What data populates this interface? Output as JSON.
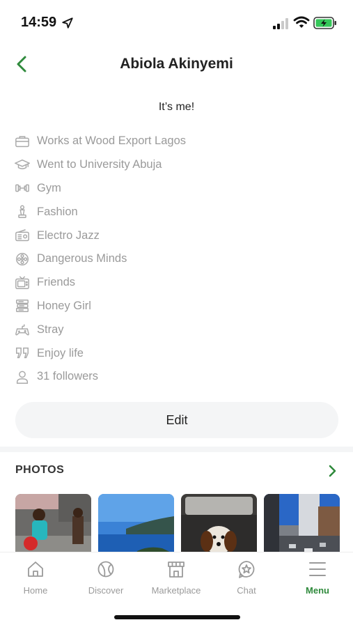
{
  "status_bar": {
    "time": "14:59"
  },
  "header": {
    "title": "Abiola Akinyemi",
    "back_icon": "chevron-left-icon"
  },
  "profile": {
    "bio": "It’s me!",
    "details": [
      {
        "icon": "briefcase-icon",
        "text": "Works at Wood Export Lagos"
      },
      {
        "icon": "graduation-cap-icon",
        "text": "Went to University Abuja"
      },
      {
        "icon": "dumbbell-icon",
        "text": "Gym"
      },
      {
        "icon": "chess-piece-icon",
        "text": "Fashion"
      },
      {
        "icon": "radio-icon",
        "text": "Electro Jazz"
      },
      {
        "icon": "film-reel-icon",
        "text": "Dangerous Minds"
      },
      {
        "icon": "tv-icon",
        "text": "Friends"
      },
      {
        "icon": "books-icon",
        "text": "Honey Girl"
      },
      {
        "icon": "gamepad-icon",
        "text": "Stray"
      },
      {
        "icon": "quote-icon",
        "text": "Enjoy life"
      },
      {
        "icon": "person-icon",
        "text": "31 followers"
      }
    ],
    "edit_label": "Edit"
  },
  "photos": {
    "title": "PHOTOS",
    "items": [
      "kids-photo",
      "sea-mountains-photo",
      "dog-in-car-photo",
      "city-street-photo"
    ]
  },
  "tab_bar": {
    "accent_color": "#2f8a3c",
    "tabs": [
      {
        "label": "Home",
        "icon": "home-icon",
        "active": false
      },
      {
        "label": "Discover",
        "icon": "ball-icon",
        "active": false
      },
      {
        "label": "Marketplace",
        "icon": "store-icon",
        "active": false
      },
      {
        "label": "Chat",
        "icon": "chat-star-icon",
        "active": false
      },
      {
        "label": "Menu",
        "icon": "menu-icon",
        "active": true
      }
    ]
  }
}
